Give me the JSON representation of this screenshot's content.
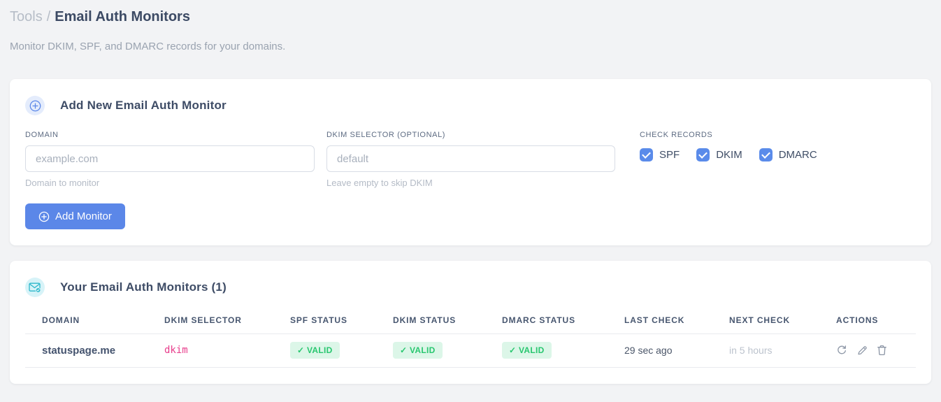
{
  "breadcrumb": {
    "tools": "Tools",
    "separator": "/",
    "current": "Email Auth Monitors"
  },
  "subtitle": "Monitor DKIM, SPF, and DMARC records for your domains.",
  "add_monitor_card": {
    "title": "Add New Email Auth Monitor",
    "fields": {
      "domain": {
        "label": "DOMAIN",
        "placeholder": "example.com",
        "value": "",
        "helper": "Domain to monitor"
      },
      "dkim_selector": {
        "label": "DKIM SELECTOR (OPTIONAL)",
        "placeholder": "default",
        "value": "",
        "helper": "Leave empty to skip DKIM"
      }
    },
    "check_records": {
      "label": "CHECK RECORDS",
      "options": [
        {
          "label": "SPF",
          "checked": true
        },
        {
          "label": "DKIM",
          "checked": true
        },
        {
          "label": "DMARC",
          "checked": true
        }
      ]
    },
    "submit_label": "Add Monitor"
  },
  "monitors_card": {
    "title": "Your Email Auth Monitors (1)",
    "count": 1,
    "table": {
      "headers": [
        "DOMAIN",
        "DKIM SELECTOR",
        "SPF STATUS",
        "DKIM STATUS",
        "DMARC STATUS",
        "LAST CHECK",
        "NEXT CHECK",
        "ACTIONS"
      ],
      "valid_glyph": "✓",
      "rows": [
        {
          "domain": "statuspage.me",
          "dkim_selector": "dkim",
          "spf_status": "VALID",
          "dkim_status": "VALID",
          "dmarc_status": "VALID",
          "last_check": "29 sec ago",
          "next_check": "in 5 hours"
        }
      ]
    }
  },
  "colors": {
    "accent_blue": "#5b87e8",
    "checkbox_blue": "#5a8bea",
    "valid_bg": "#dcf6e8",
    "valid_text": "#28c76f",
    "selector_pink": "#e83e8c",
    "icon_teal": "#2cb8cb",
    "page_bg": "#f2f3f5"
  }
}
